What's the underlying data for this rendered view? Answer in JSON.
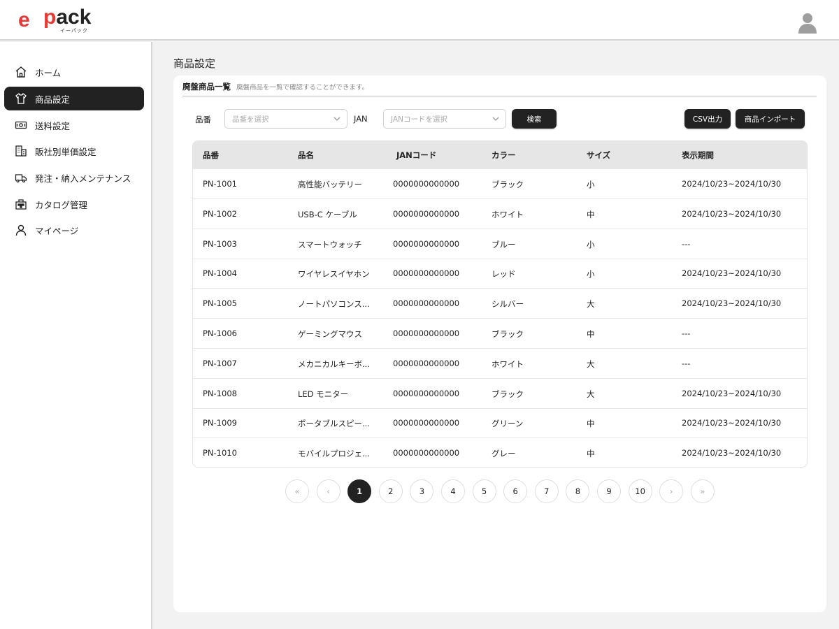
{
  "header": {
    "logo_e": "e",
    "logo_p": "p",
    "logo_ack": "ack",
    "logo_sub": "イーパック"
  },
  "sidebar": {
    "items": [
      {
        "label": "ホーム",
        "icon": "home-icon",
        "active": false
      },
      {
        "label": "商品設定",
        "icon": "shirt-icon",
        "active": true
      },
      {
        "label": "送料設定",
        "icon": "money-icon",
        "active": false
      },
      {
        "label": "販社別単価設定",
        "icon": "building-icon",
        "active": false
      },
      {
        "label": "発注・納入メンテナンス",
        "icon": "truck-icon",
        "active": false
      },
      {
        "label": "カタログ管理",
        "icon": "catalog-icon",
        "active": false
      },
      {
        "label": "マイページ",
        "icon": "person-icon",
        "active": false
      }
    ]
  },
  "main": {
    "page_title": "商品設定",
    "card_title": "廃盤商品一覧",
    "card_desc": "廃盤商品を一覧で確認することができます。",
    "filters": {
      "product_no_label": "品番",
      "product_no_placeholder": "品番を選択",
      "jan_label": "JAN",
      "jan_placeholder": "JANコードを選択",
      "search_label": "検索",
      "csv_label": "CSV出力",
      "import_label": "商品インポート"
    },
    "table": {
      "headers": [
        "品番",
        "品名",
        "JANコード",
        "カラー",
        "サイズ",
        "表示期間"
      ],
      "rows": [
        [
          "PN-1001",
          "高性能バッテリー",
          "0000000000000",
          "ブラック",
          "小",
          "2024/10/23~2024/10/30"
        ],
        [
          "PN-1002",
          "USB-C ケーブル",
          "0000000000000",
          "ホワイト",
          "中",
          "2024/10/23~2024/10/30"
        ],
        [
          "PN-1003",
          "スマートウォッチ",
          "0000000000000",
          "ブルー",
          "小",
          "---"
        ],
        [
          "PN-1004",
          "ワイヤレスイヤホン",
          "0000000000000",
          "レッド",
          "小",
          "2024/10/23~2024/10/30"
        ],
        [
          "PN-1005",
          "ノートパソコンス...",
          "0000000000000",
          "シルバー",
          "大",
          "2024/10/23~2024/10/30"
        ],
        [
          "PN-1006",
          "ゲーミングマウス",
          "0000000000000",
          "ブラック",
          "中",
          "---"
        ],
        [
          "PN-1007",
          "メカニカルキーボ...",
          "0000000000000",
          "ホワイト",
          "大",
          "---"
        ],
        [
          "PN-1008",
          "LED モニター",
          "0000000000000",
          "ブラック",
          "大",
          "2024/10/23~2024/10/30"
        ],
        [
          "PN-1009",
          "ポータブルスピー...",
          "0000000000000",
          "グリーン",
          "中",
          "2024/10/23~2024/10/30"
        ],
        [
          "PN-1010",
          "モバイルプロジェ...",
          "0000000000000",
          "グレー",
          "中",
          "2024/10/23~2024/10/30"
        ]
      ]
    },
    "pagination": {
      "first": "«",
      "prev": "‹",
      "pages": [
        "1",
        "2",
        "3",
        "4",
        "5",
        "6",
        "7",
        "8",
        "9",
        "10"
      ],
      "current": "1",
      "next": "›",
      "last": "»"
    }
  },
  "colors": {
    "accent": "#e53935",
    "dark": "#222222",
    "background": "#f2f2f2"
  }
}
